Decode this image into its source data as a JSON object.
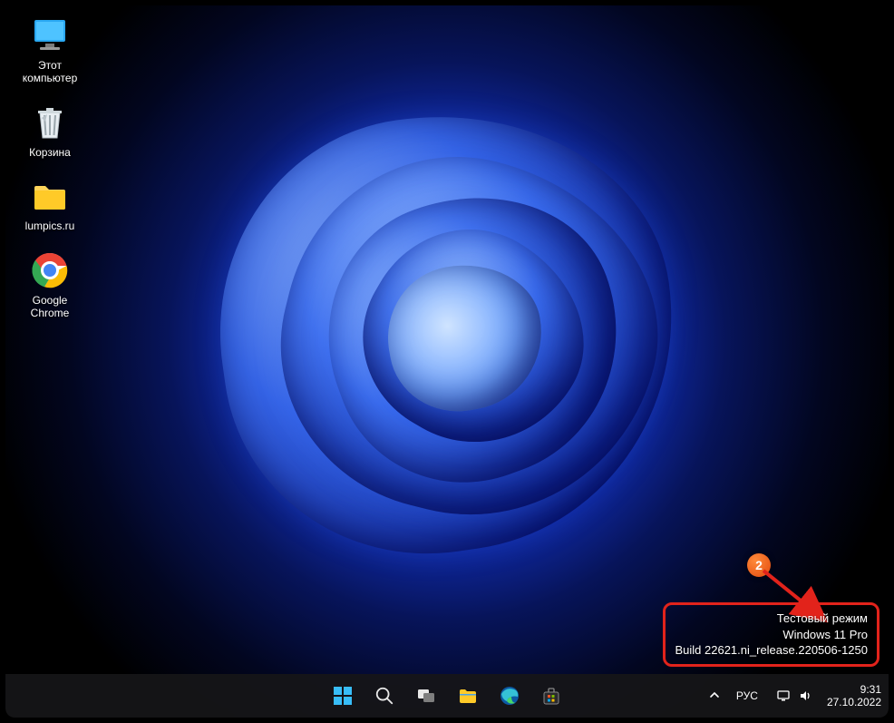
{
  "desktop": {
    "icons": [
      {
        "id": "this-pc",
        "label": "Этот\nкомпьютер"
      },
      {
        "id": "recycle-bin",
        "label": "Корзина"
      },
      {
        "id": "folder-lumpics",
        "label": "lumpics.ru"
      },
      {
        "id": "chrome",
        "label": "Google\nChrome"
      }
    ]
  },
  "watermark": {
    "line1": "Тестовый режим",
    "line2": "Windows 11 Pro",
    "line3": "Build 22621.ni_release.220506-1250"
  },
  "annotation": {
    "badge": "2"
  },
  "taskbar": {
    "items": [
      "start",
      "search",
      "task-view",
      "explorer",
      "edge",
      "store"
    ],
    "tray": {
      "chevron": "˄",
      "language": "РУС"
    },
    "clock": {
      "time": "9:31",
      "date": "27.10.2022"
    }
  }
}
